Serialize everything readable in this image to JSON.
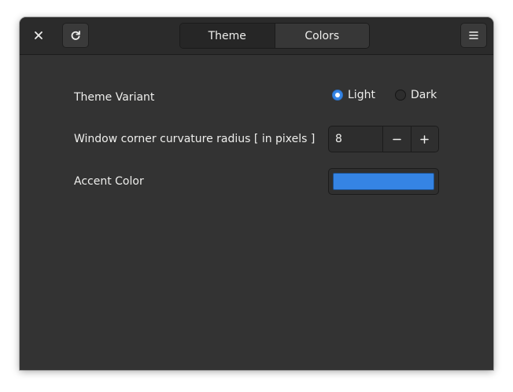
{
  "header": {
    "close_icon": "close-icon",
    "reload_icon": "reload-icon",
    "menu_icon": "hamburger-menu-icon",
    "tabs": [
      {
        "label": "Theme",
        "active": true
      },
      {
        "label": "Colors",
        "active": false
      }
    ]
  },
  "theme_variant": {
    "label": "Theme Variant",
    "options": [
      {
        "label": "Light",
        "selected": true
      },
      {
        "label": "Dark",
        "selected": false
      }
    ]
  },
  "corner_radius": {
    "label": "Window corner curvature radius [ in pixels ]",
    "value": "8",
    "decrement_icon": "minus-icon",
    "increment_icon": "plus-icon"
  },
  "accent_color": {
    "label": "Accent Color",
    "value": "#3584e4"
  },
  "colors": {
    "window_bg": "#333333",
    "headerbar_bg": "#2b2b2b",
    "accent": "#3584e4",
    "text": "#eeeeec"
  }
}
